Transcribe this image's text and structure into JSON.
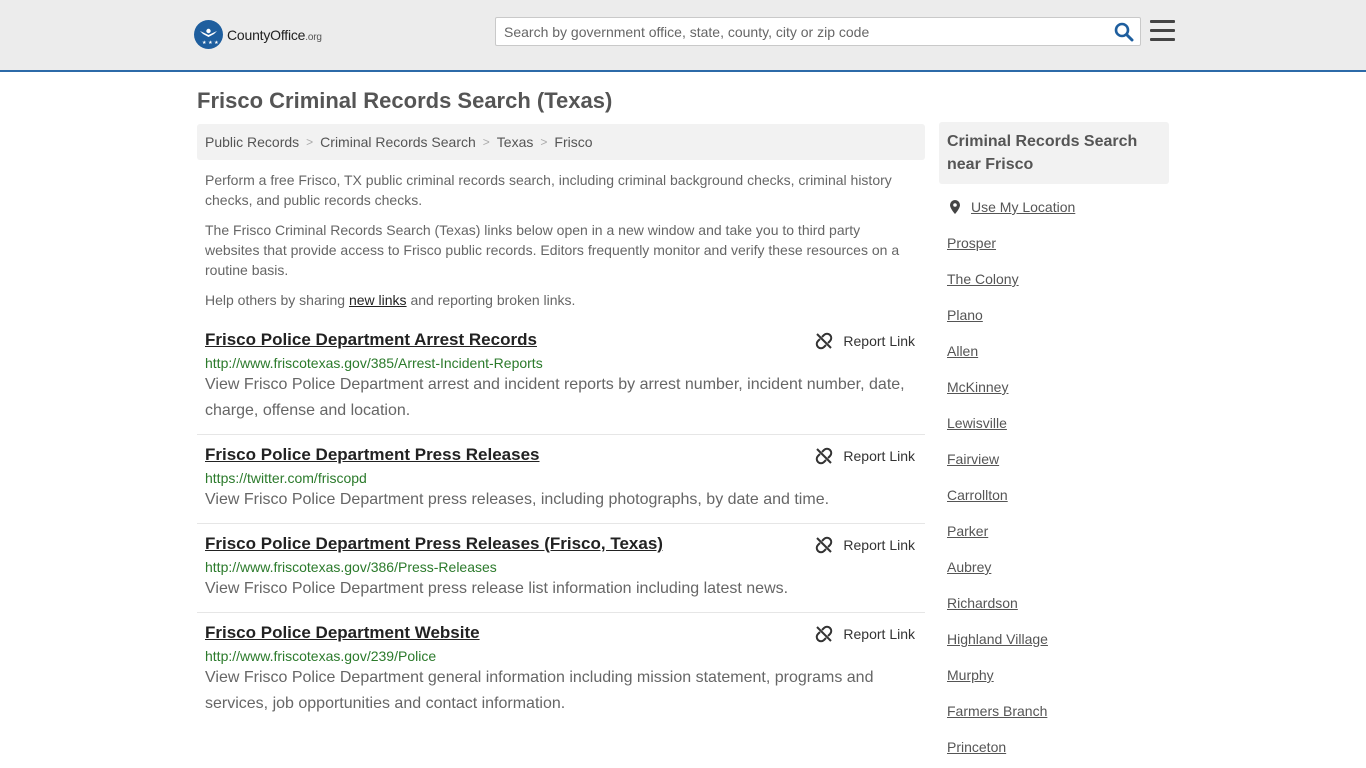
{
  "header": {
    "logo_main": "CountyOffice",
    "logo_suffix": ".org",
    "search_placeholder": "Search by government office, state, county, city or zip code"
  },
  "page_title": "Frisco Criminal Records Search (Texas)",
  "breadcrumb": [
    "Public Records",
    "Criminal Records Search",
    "Texas",
    "Frisco"
  ],
  "intro": {
    "p1": "Perform a free Frisco, TX public criminal records search, including criminal background checks, criminal history checks, and public records checks.",
    "p2": "The Frisco Criminal Records Search (Texas) links below open in a new window and take you to third party websites that provide access to Frisco public records. Editors frequently monitor and verify these resources on a routine basis.",
    "p3_before": "Help others by sharing ",
    "p3_link": "new links",
    "p3_after": " and reporting broken links."
  },
  "report_label": "Report Link",
  "results": [
    {
      "title": "Frisco Police Department Arrest Records",
      "url": "http://www.friscotexas.gov/385/Arrest-Incident-Reports",
      "desc": "View Frisco Police Department arrest and incident reports by arrest number, incident number, date, charge, offense and location."
    },
    {
      "title": "Frisco Police Department Press Releases",
      "url": "https://twitter.com/friscopd",
      "desc": "View Frisco Police Department press releases, including photographs, by date and time."
    },
    {
      "title": "Frisco Police Department Press Releases (Frisco, Texas)",
      "url": "http://www.friscotexas.gov/386/Press-Releases",
      "desc": "View Frisco Police Department press release list information including latest news."
    },
    {
      "title": "Frisco Police Department Website",
      "url": "http://www.friscotexas.gov/239/Police",
      "desc": "View Frisco Police Department general information including mission statement, programs and services, job opportunities and contact information."
    }
  ],
  "sidebar": {
    "heading": "Criminal Records Search near Frisco",
    "use_location": "Use My Location",
    "cities": [
      "Prosper",
      "The Colony",
      "Plano",
      "Allen",
      "McKinney",
      "Lewisville",
      "Fairview",
      "Carrollton",
      "Parker",
      "Aubrey",
      "Richardson",
      "Highland Village",
      "Murphy",
      "Farmers Branch",
      "Princeton"
    ]
  },
  "colors": {
    "accent": "#2c6aa8",
    "url_green": "#2b7a2b",
    "header_bg": "#ececec"
  }
}
